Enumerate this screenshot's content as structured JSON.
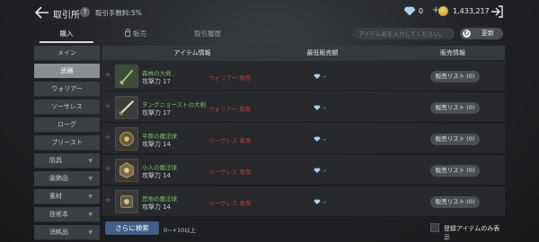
{
  "header": {
    "title": "取引所",
    "fee_text": "取引手数料:5%",
    "diamond_value": "0",
    "plus": "+",
    "gold_value": "1,433,217"
  },
  "tabs": {
    "buy": "購入",
    "sell": "販売",
    "history": "取引履歴"
  },
  "search": {
    "placeholder": "アイテム名を入力してください。",
    "refresh_label": "更新"
  },
  "sidebar": {
    "items": [
      {
        "label": "メイン"
      },
      {
        "label": "武器"
      },
      {
        "label": "ウォリアー"
      },
      {
        "label": "ソーサレス"
      },
      {
        "label": "ローグ"
      },
      {
        "label": "プリースト"
      },
      {
        "label": "防具"
      },
      {
        "label": "装飾品"
      },
      {
        "label": "素材"
      },
      {
        "label": "技術本"
      },
      {
        "label": "消耗品"
      }
    ]
  },
  "table": {
    "col_item": "アイテム情報",
    "col_price": "最低販売額",
    "col_listing": "販売情報",
    "rows": [
      {
        "name": "森林の大剣",
        "atk": "攻撃力 17",
        "class": "ウォリアー 専用",
        "price": "-",
        "listing": "販売リスト (0)"
      },
      {
        "name": "タングニョーストの大剣",
        "atk": "攻撃力 17",
        "class": "ウォリアー 専用",
        "price": "-",
        "listing": "販売リスト (0)"
      },
      {
        "name": "平原の魔法球",
        "atk": "攻撃力 14",
        "class": "ソーサレス 専用",
        "price": "-",
        "listing": "販売リスト (0)"
      },
      {
        "name": "小人の魔法球",
        "atk": "攻撃力 14",
        "class": "ソーサレス 専用",
        "price": "-",
        "listing": "販売リスト (0)"
      },
      {
        "name": "荒地の魔法球",
        "atk": "攻撃力 14",
        "class": "ソーサレス 専用",
        "price": "-",
        "listing": "販売リスト (0)"
      }
    ]
  },
  "bottom": {
    "more_label": "さらに検索",
    "range": "0~+10以上",
    "registered_only": "登録アイテムのみ表示"
  },
  "colors": {
    "accent_button": "#3e5f8a",
    "item_name_green": "#7fc25e",
    "class_red": "#c03a36"
  }
}
